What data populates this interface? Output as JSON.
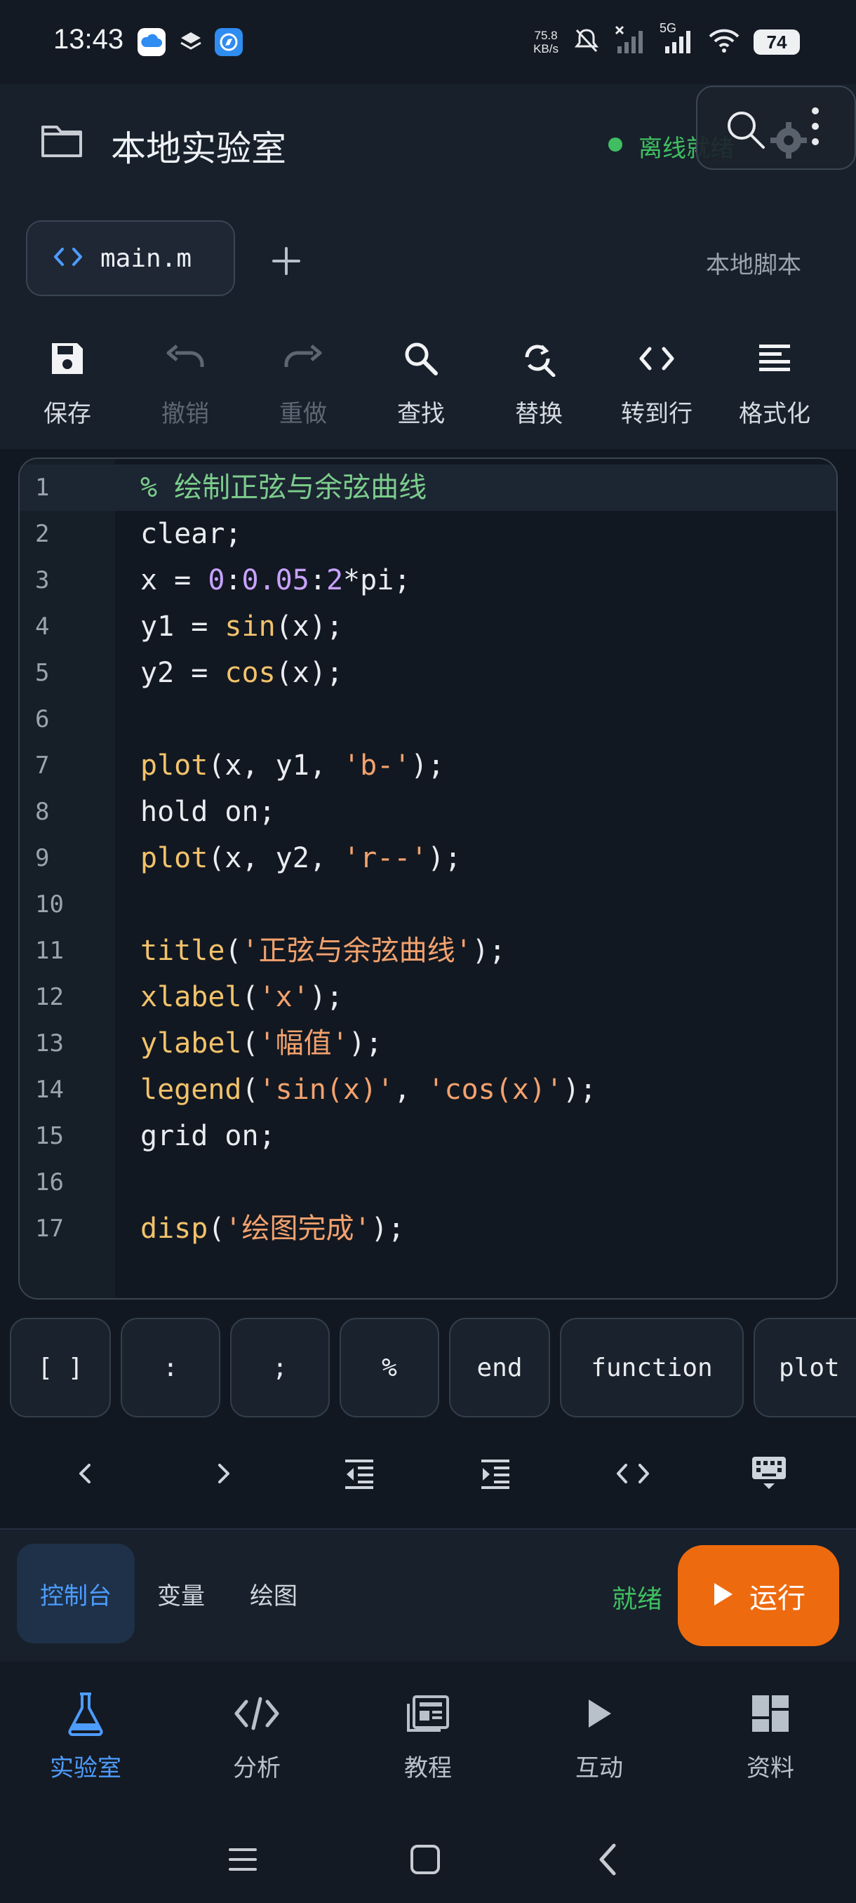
{
  "status_bar": {
    "time": "13:43",
    "net_speed_value": "75.8",
    "net_speed_unit": "KB/s",
    "network_type": "5G",
    "battery": "74"
  },
  "header": {
    "title": "本地实验室",
    "status": "离线就绪",
    "status_color": "#3fbf61"
  },
  "tabs": {
    "file_name": "main.m",
    "script_type": "本地脚本"
  },
  "toolbar": {
    "items": [
      {
        "label": "保存",
        "icon": "save-icon",
        "enabled": true
      },
      {
        "label": "撤销",
        "icon": "undo-icon",
        "enabled": false
      },
      {
        "label": "重做",
        "icon": "redo-icon",
        "enabled": false
      },
      {
        "label": "查找",
        "icon": "search-icon",
        "enabled": true
      },
      {
        "label": "替换",
        "icon": "replace-icon",
        "enabled": true
      },
      {
        "label": "转到行",
        "icon": "goto-line-icon",
        "enabled": true
      },
      {
        "label": "格式化",
        "icon": "format-icon",
        "enabled": true
      }
    ]
  },
  "editor": {
    "active_line": 1,
    "lines": [
      {
        "num": "1",
        "tokens": [
          {
            "t": "% 绘制正弦与余弦曲线",
            "k": "comment"
          }
        ]
      },
      {
        "num": "2",
        "tokens": [
          {
            "t": "clear;",
            "k": "plain"
          }
        ]
      },
      {
        "num": "3",
        "tokens": [
          {
            "t": "x = ",
            "k": "plain"
          },
          {
            "t": "0",
            "k": "num"
          },
          {
            "t": ":",
            "k": "plain"
          },
          {
            "t": "0.05",
            "k": "num"
          },
          {
            "t": ":",
            "k": "plain"
          },
          {
            "t": "2",
            "k": "num"
          },
          {
            "t": "*pi;",
            "k": "plain"
          }
        ]
      },
      {
        "num": "4",
        "tokens": [
          {
            "t": "y1 = ",
            "k": "plain"
          },
          {
            "t": "sin",
            "k": "func"
          },
          {
            "t": "(x);",
            "k": "plain"
          }
        ]
      },
      {
        "num": "5",
        "tokens": [
          {
            "t": "y2 = ",
            "k": "plain"
          },
          {
            "t": "cos",
            "k": "func"
          },
          {
            "t": "(x);",
            "k": "plain"
          }
        ]
      },
      {
        "num": "6",
        "tokens": []
      },
      {
        "num": "7",
        "tokens": [
          {
            "t": "plot",
            "k": "func"
          },
          {
            "t": "(x, y1, ",
            "k": "plain"
          },
          {
            "t": "'b-'",
            "k": "str"
          },
          {
            "t": ");",
            "k": "plain"
          }
        ]
      },
      {
        "num": "8",
        "tokens": [
          {
            "t": "hold on;",
            "k": "plain"
          }
        ]
      },
      {
        "num": "9",
        "tokens": [
          {
            "t": "plot",
            "k": "func"
          },
          {
            "t": "(x, y2, ",
            "k": "plain"
          },
          {
            "t": "'r--'",
            "k": "str"
          },
          {
            "t": ");",
            "k": "plain"
          }
        ]
      },
      {
        "num": "10",
        "tokens": []
      },
      {
        "num": "11",
        "tokens": [
          {
            "t": "title",
            "k": "func"
          },
          {
            "t": "(",
            "k": "plain"
          },
          {
            "t": "'正弦与余弦曲线'",
            "k": "str"
          },
          {
            "t": ");",
            "k": "plain"
          }
        ]
      },
      {
        "num": "12",
        "tokens": [
          {
            "t": "xlabel",
            "k": "func"
          },
          {
            "t": "(",
            "k": "plain"
          },
          {
            "t": "'x'",
            "k": "str"
          },
          {
            "t": ");",
            "k": "plain"
          }
        ]
      },
      {
        "num": "13",
        "tokens": [
          {
            "t": "ylabel",
            "k": "func"
          },
          {
            "t": "(",
            "k": "plain"
          },
          {
            "t": "'幅值'",
            "k": "str"
          },
          {
            "t": ");",
            "k": "plain"
          }
        ]
      },
      {
        "num": "14",
        "tokens": [
          {
            "t": "legend",
            "k": "func"
          },
          {
            "t": "(",
            "k": "plain"
          },
          {
            "t": "'sin(x)'",
            "k": "str"
          },
          {
            "t": ", ",
            "k": "plain"
          },
          {
            "t": "'cos(x)'",
            "k": "str"
          },
          {
            "t": ");",
            "k": "plain"
          }
        ]
      },
      {
        "num": "15",
        "tokens": [
          {
            "t": "grid on;",
            "k": "plain"
          }
        ]
      },
      {
        "num": "16",
        "tokens": []
      },
      {
        "num": "17",
        "tokens": [
          {
            "t": "disp",
            "k": "func"
          },
          {
            "t": "(",
            "k": "plain"
          },
          {
            "t": "'绘图完成'",
            "k": "str"
          },
          {
            "t": ");",
            "k": "plain"
          }
        ]
      }
    ]
  },
  "quick_keys": [
    "[ ]",
    ":",
    ";",
    "%",
    "end",
    "function",
    "plot"
  ],
  "nav_keys": [
    "cursor-left-icon",
    "cursor-right-icon",
    "outdent-icon",
    "indent-icon",
    "code-brackets-icon",
    "keyboard-hide-icon"
  ],
  "console_tabs": [
    {
      "label": "控制台",
      "active": true
    },
    {
      "label": "变量",
      "active": false
    },
    {
      "label": "绘图",
      "active": false
    }
  ],
  "console": {
    "status": "就绪",
    "run_label": "运行",
    "run_color": "#ee6a0f"
  },
  "bottom_nav": [
    {
      "label": "实验室",
      "icon": "flask-icon",
      "active": true
    },
    {
      "label": "分析",
      "icon": "code-analysis-icon",
      "active": false
    },
    {
      "label": "教程",
      "icon": "book-icon",
      "active": false
    },
    {
      "label": "互动",
      "icon": "play-icon",
      "active": false
    },
    {
      "label": "资料",
      "icon": "dashboard-icon",
      "active": false
    }
  ],
  "theme": {
    "accent": "#4d9cff",
    "success": "#3fbf61"
  }
}
